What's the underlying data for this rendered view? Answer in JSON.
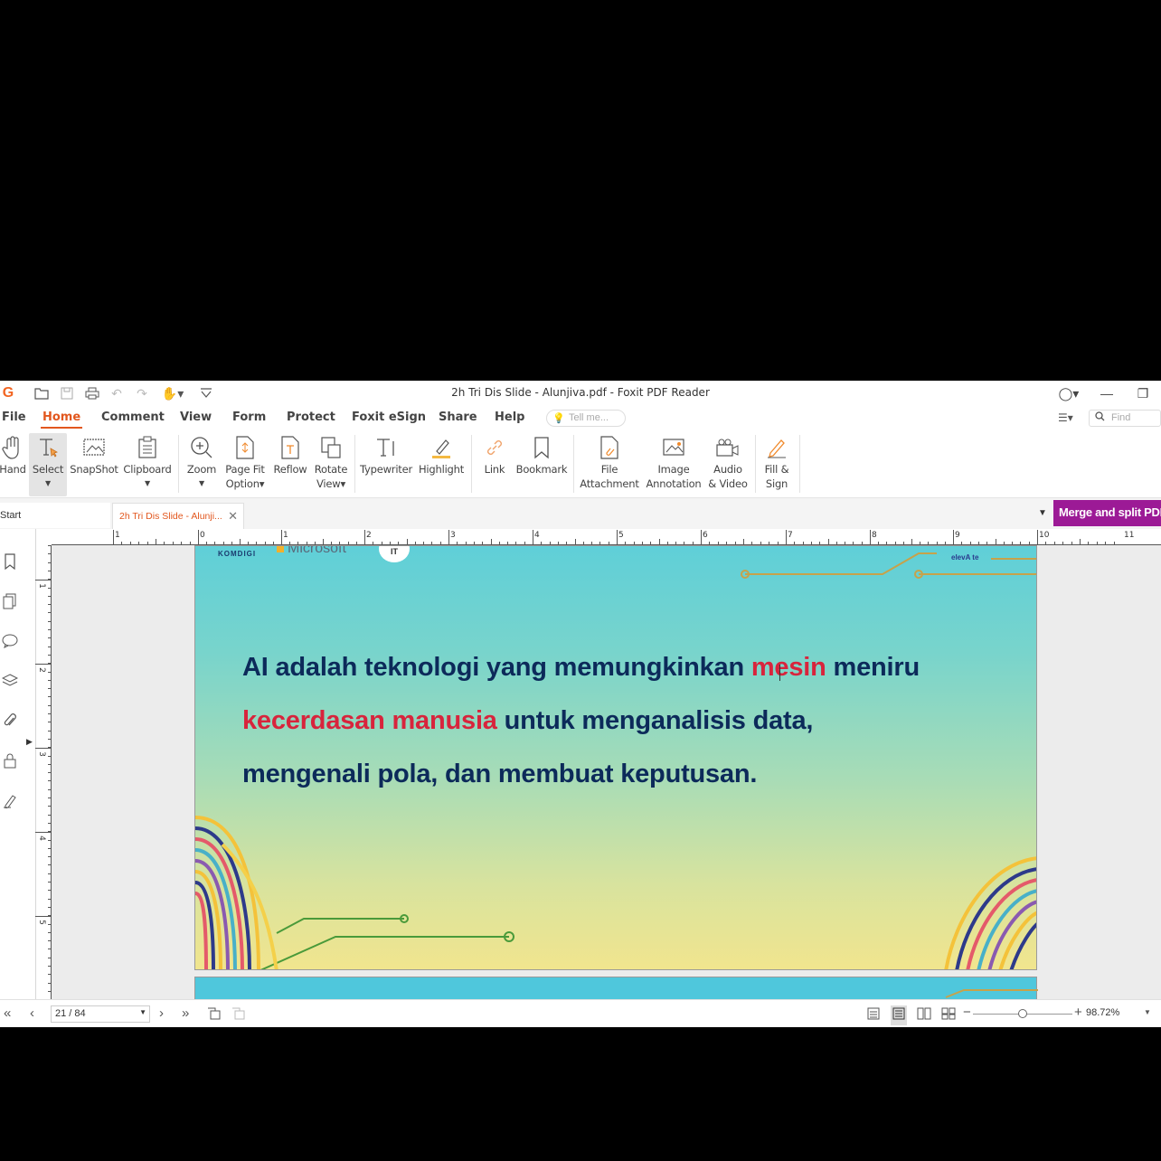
{
  "window": {
    "title": "2h Tri Dis Slide - Alunjiva.pdf - Foxit PDF Reader",
    "app_logo": "G"
  },
  "quick_access": [
    "open-icon",
    "save-icon",
    "print-icon",
    "undo-icon",
    "redo-icon",
    "hand-tool-icon",
    "customize-icon"
  ],
  "menu": {
    "items": [
      "File",
      "Home",
      "Comment",
      "View",
      "Form",
      "Protect",
      "Foxit eSign",
      "Share",
      "Help"
    ],
    "active": "Home",
    "tellme_placeholder": "Tell me...",
    "find_placeholder": "Find"
  },
  "ribbon": {
    "hand": "Hand",
    "select": "Select",
    "snapshot": "SnapShot",
    "clipboard": "Clipboard",
    "zoom": "Zoom",
    "pagefit_1": "Page Fit",
    "pagefit_2": "Option▾",
    "reflow": "Reflow",
    "rotate_1": "Rotate",
    "rotate_2": "View▾",
    "typewriter": "Typewriter",
    "highlight": "Highlight",
    "link": "Link",
    "bookmark": "Bookmark",
    "file_1": "File",
    "file_2": "Attachment",
    "image_1": "Image",
    "image_2": "Annotation",
    "audio_1": "Audio",
    "audio_2": "& Video",
    "fill_1": "Fill &",
    "fill_2": "Sign"
  },
  "tabs": {
    "start": "Start",
    "doc": "2h Tri Dis Slide - Alunji...",
    "merge": "Merge and split PDFs"
  },
  "ruler": {
    "h_labels": [
      "1",
      "0",
      "1",
      "2",
      "3",
      "4",
      "5",
      "6",
      "7",
      "8",
      "9",
      "10",
      "11"
    ],
    "v_labels": [
      "1",
      "2",
      "3",
      "4",
      "5"
    ]
  },
  "slide": {
    "logos": {
      "komdigi": "KOMDIGI",
      "microsoft": "Microsoft",
      "mid": "IT",
      "elevate": "elevA te"
    },
    "line1_a": "AI adalah teknologi yang memungkinkan ",
    "line1_b": "mesin",
    "line1_c": " meniru",
    "line2_a": "kecerdasan manusia",
    "line2_b": " untuk menganalisis data,",
    "line3": "mengenali pola, dan membuat keputusan.",
    "colors": {
      "text": "#0c2a5a",
      "highlight": "#d8243c"
    }
  },
  "status": {
    "page": "21 / 84",
    "zoom": "98.72%"
  },
  "colors": {
    "accent": "#e2571e",
    "merge": "#9c1a96"
  }
}
